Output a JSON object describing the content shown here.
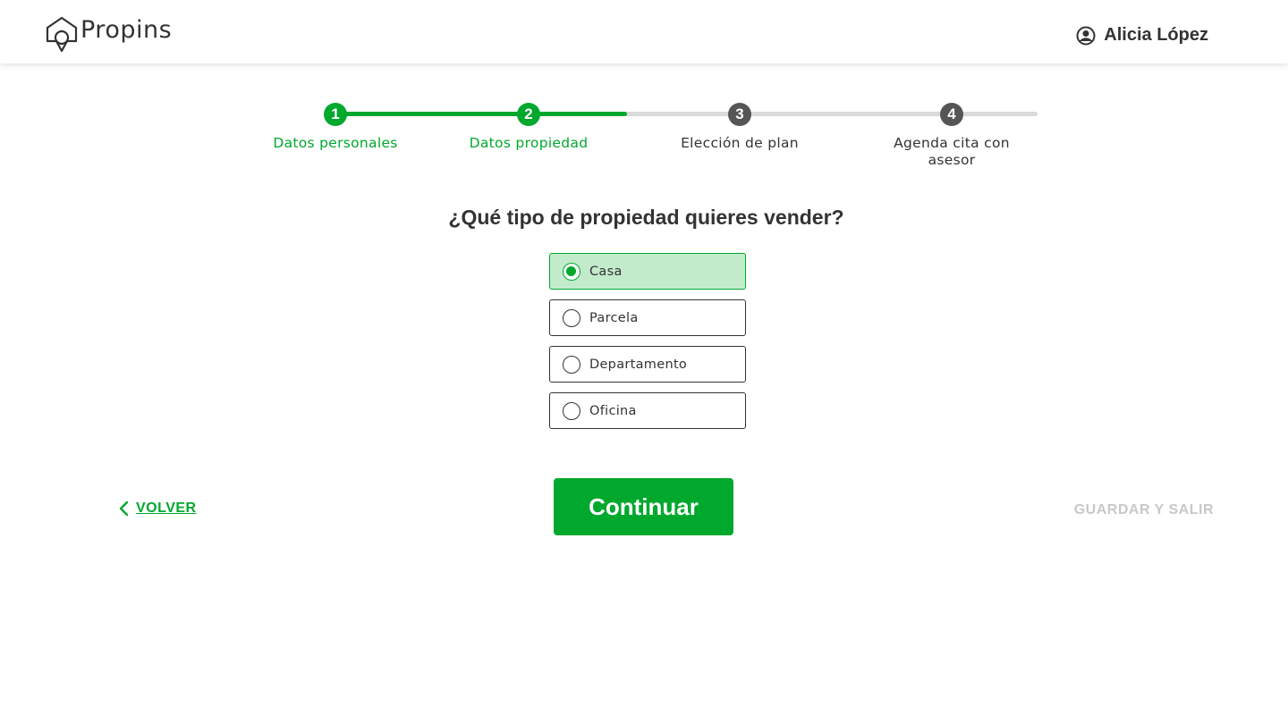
{
  "header": {
    "logo_text": "Propins",
    "user_name": "Alicia López",
    "user_icon": "user-circle-icon"
  },
  "stepper": {
    "progress": 0.415,
    "steps": [
      {
        "number": "1",
        "label": "Datos personales",
        "status": "done"
      },
      {
        "number": "2",
        "label": "Datos propiedad",
        "status": "done"
      },
      {
        "number": "3",
        "label": "Elección de plan",
        "status": "todo"
      },
      {
        "number": "4",
        "label": "Agenda cita con asesor",
        "status": "todo"
      }
    ]
  },
  "form": {
    "question": "¿Qué tipo de propiedad quieres vender?",
    "options": [
      {
        "label": "Casa",
        "selected": true
      },
      {
        "label": "Parcela",
        "selected": false
      },
      {
        "label": "Departamento",
        "selected": false
      },
      {
        "label": "Oficina",
        "selected": false
      }
    ]
  },
  "actions": {
    "back_label": "VOLVER",
    "continue_label": "Continuar",
    "save_label": "GUARDAR Y SALIR"
  },
  "colors": {
    "accent": "#00a82d",
    "selected_bg": "#c2ebcc",
    "inactive_step": "#555555",
    "disabled_text": "#c8c8c8"
  }
}
